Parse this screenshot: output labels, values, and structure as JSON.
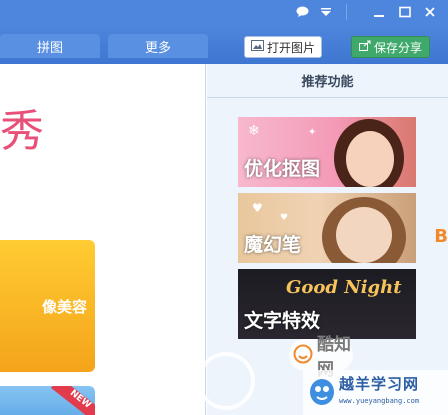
{
  "titlebar": {
    "icons": [
      "chat-bubble-icon",
      "dropdown-arrow-icon",
      "minimize-icon",
      "maximize-icon",
      "close-icon"
    ]
  },
  "tabs": [
    {
      "label": "拼图"
    },
    {
      "label": "更多"
    }
  ],
  "toolbar": {
    "open_label": "打开图片",
    "save_label": "保存分享"
  },
  "main": {
    "hero_char": "秀",
    "orange_card_label": "像美容",
    "new_ribbon": "NEW"
  },
  "panel": {
    "title": "推荐功能",
    "features": [
      {
        "label": "优化抠图"
      },
      {
        "label": "魔幻笔"
      },
      {
        "label": "文字特效",
        "art_text": "Good Night"
      }
    ],
    "side_mark": "B"
  },
  "watermarks": {
    "logo1_text": "酷知网",
    "logo2_text": "越羊学习网",
    "logo2_url": "www.yueyangbang.com"
  },
  "colors": {
    "titlebar": "#4f86dd",
    "panel_bg": "#eef4fc",
    "save_button": "#3fa96b",
    "orange_card": "#f4a41a"
  }
}
